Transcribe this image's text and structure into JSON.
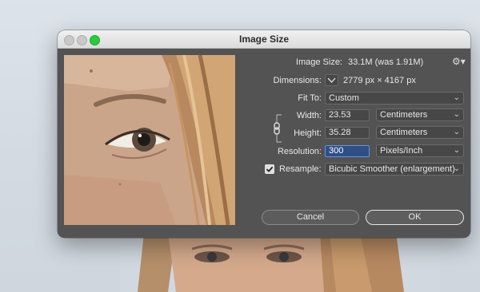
{
  "dialog": {
    "title": "Image Size"
  },
  "rows": {
    "image_size_label": "Image Size:",
    "image_size_value": "33.1M (was 1.91M)",
    "dimensions_label": "Dimensions:",
    "dimensions_value": "2779 px  ×  4167 px",
    "fit_to_label": "Fit To:",
    "fit_to_value": "Custom",
    "width_label": "Width:",
    "width_value": "23.53",
    "width_unit": "Centimeters",
    "height_label": "Height:",
    "height_value": "35.28",
    "height_unit": "Centimeters",
    "resolution_label": "Resolution:",
    "resolution_value": "300",
    "resolution_unit": "Pixels/Inch",
    "resample_label": "Resample:",
    "resample_value": "Bicubic Smoother (enlargement)",
    "resample_checked": true
  },
  "buttons": {
    "cancel": "Cancel",
    "ok": "OK"
  },
  "icons": {
    "gear": "gear-icon",
    "chain": "chain-link-icon",
    "chevron": "chevron-down-icon",
    "checkmark": "checkmark-icon"
  },
  "colors": {
    "dialog_bg": "#535353",
    "field_bg": "#474747",
    "active_field_bg": "#2f4f86",
    "zoom_button": "#2cc840"
  }
}
